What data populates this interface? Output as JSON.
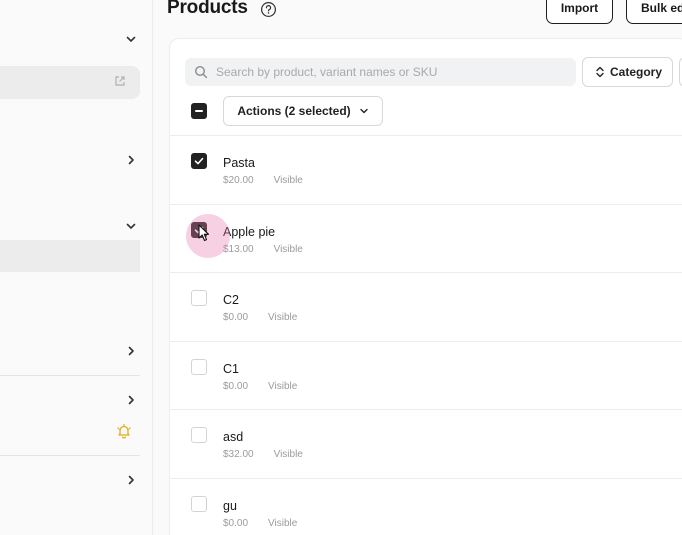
{
  "header": {
    "title": "Products",
    "import_label": "Import",
    "bulk_label": "Bulk ed"
  },
  "toolbar": {
    "search_placeholder": "Search by product, variant names or SKU",
    "category_label": "Category",
    "actions_label": "Actions (2 selected)"
  },
  "products": [
    {
      "name": "Pasta",
      "price": "$20.00",
      "status": "Visible",
      "checked": true
    },
    {
      "name": "Apple pie",
      "price": "$13.00",
      "status": "Visible",
      "checked": true
    },
    {
      "name": "C2",
      "price": "$0.00",
      "status": "Visible",
      "checked": false
    },
    {
      "name": "C1",
      "price": "$0.00",
      "status": "Visible",
      "checked": false
    },
    {
      "name": "asd",
      "price": "$32.00",
      "status": "Visible",
      "checked": false
    },
    {
      "name": "gu",
      "price": "$0.00",
      "status": "Visible",
      "checked": false
    }
  ],
  "icons": {
    "help": "question-circle-icon",
    "search": "search-icon",
    "sort": "sort-icon",
    "notification": "bell-icon",
    "external": "external-link-icon"
  },
  "colors": {
    "accent_dark": "#222222",
    "bell": "#e2ad1c",
    "click_highlight": "#ec78af"
  }
}
